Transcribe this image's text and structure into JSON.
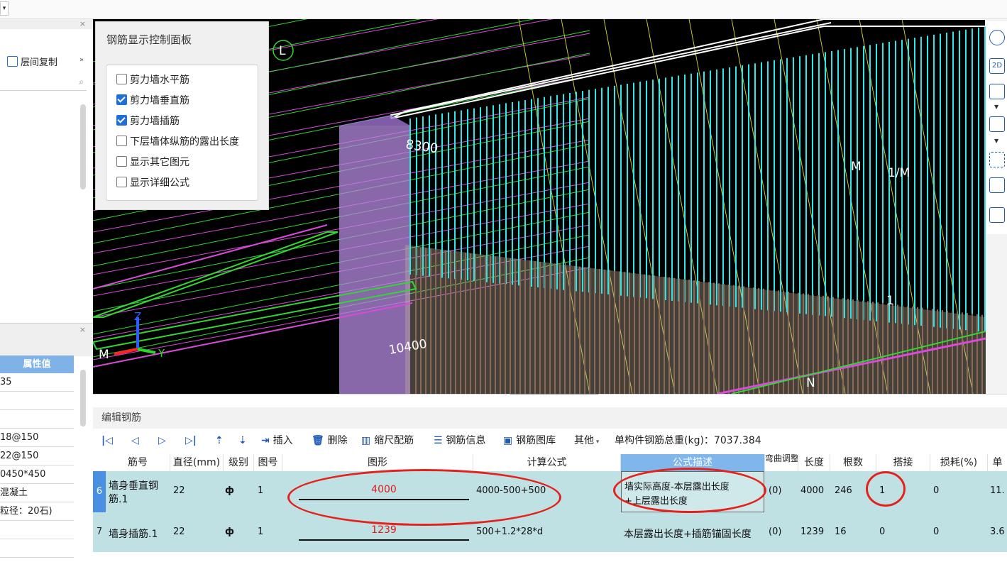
{
  "topbar": {
    "dropdown_glyph": "▾"
  },
  "left_panel": {
    "close_glyph": "×",
    "copy_floor_label": "层间复制",
    "more_glyph": "»",
    "search_icon": "search-icon",
    "props": {
      "header": "属性值",
      "rows": [
        "35",
        "",
        "",
        "18@150",
        "22@150",
        "0450*450",
        "混凝土",
        "粒径：20石)",
        "",
        ""
      ]
    }
  },
  "control_panel": {
    "title": "钢筋显示控制面板",
    "options": [
      {
        "label": "剪力墙水平筋",
        "checked": false
      },
      {
        "label": "剪力墙垂直筋",
        "checked": true
      },
      {
        "label": "剪力墙插筋",
        "checked": true
      },
      {
        "label": "下层墙体纵筋的露出长度",
        "checked": false
      },
      {
        "label": "显示其它图元",
        "checked": false
      },
      {
        "label": "显示详细公式",
        "checked": false
      }
    ]
  },
  "viewport": {
    "labels": {
      "l1": "8300",
      "l2": "10400",
      "l3": "M",
      "l4": "1/M",
      "l5": "L",
      "l6": "N",
      "l7": "1",
      "l8": "M",
      "axis_z": "Z",
      "axis_y": "Y"
    },
    "colors": {
      "bg": "#000000",
      "rebar": "#2ee6e6",
      "beam": "#33d633",
      "magenta": "#d94ad9",
      "white": "#ffffff",
      "column": "#b58be0"
    }
  },
  "right_tools": {
    "t2d": "2D"
  },
  "bottom": {
    "title": "编辑钢筋",
    "toolbar": {
      "insert": "插入",
      "delete": "删除",
      "scale": "缩尺配筋",
      "info": "钢筋信息",
      "library": "钢筋图库",
      "other": "其他",
      "total": "单构件钢筋总重(kg)：7037.384"
    },
    "headers": [
      "筋号",
      "直径(mm)",
      "级别",
      "图号",
      "图形",
      "计算公式",
      "公式描述",
      "弯曲调整",
      "长度",
      "根数",
      "搭接",
      "损耗(%)",
      "单"
    ],
    "rows": [
      {
        "num": "6",
        "name1": "墙身垂直钢",
        "name2": "筋.1",
        "dia": "22",
        "grade": "ф",
        "fig": "1",
        "shape_val": "4000",
        "formula": "4000-500+500",
        "desc1": "墙实际高度-本层露出长度",
        "desc2": "+上层露出长度",
        "bend": "(0)",
        "len": "4000",
        "count": "246",
        "lap": "1",
        "loss": "0",
        "unit": "11."
      },
      {
        "num": "7",
        "name1": "墙身插筋.1",
        "name2": "",
        "dia": "22",
        "grade": "ф",
        "fig": "1",
        "shape_val": "1239",
        "formula": "500+1.2*28*d",
        "desc1": "本层露出长度+插筋锚固长度",
        "desc2": "",
        "bend": "(0)",
        "len": "1239",
        "count": "16",
        "lap": "0",
        "loss": "0",
        "unit": "3.6"
      }
    ]
  }
}
